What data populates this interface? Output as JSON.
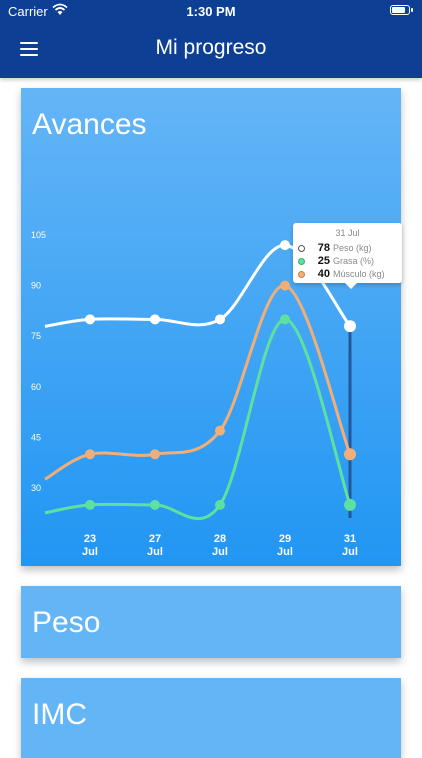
{
  "status_bar": {
    "carrier": "Carrier",
    "time": "1:30 PM"
  },
  "header": {
    "title": "Mi progreso",
    "menu_icon": "hamburger-menu-icon"
  },
  "cards": [
    {
      "title": "Avances"
    },
    {
      "title": "Peso"
    },
    {
      "title": "IMC"
    }
  ],
  "tooltip": {
    "date": "31 Jul",
    "rows": [
      {
        "value": "78",
        "label": "Peso (kg)"
      },
      {
        "value": "25",
        "label": "Grasa (%)"
      },
      {
        "value": "40",
        "label": "Músculo (kg)"
      }
    ]
  },
  "colors": {
    "header_bg": "#0d3f95",
    "card_gradient_top": "#64b5f6",
    "card_gradient_bottom": "#2196f3",
    "peso": "#ffffff",
    "grasa": "#5ee0a0",
    "musculo": "#f2ae76",
    "selection_line": "#24579a"
  },
  "chart_data": {
    "type": "line",
    "categories": [
      "23\nJul",
      "27\nJul",
      "28\nJul",
      "29\nJul",
      "31\nJul"
    ],
    "y_ticks": [
      30,
      45,
      60,
      75,
      90,
      105
    ],
    "ylim": [
      30,
      105
    ],
    "grid": false,
    "legend": "tooltip",
    "selected_index": 4,
    "series": [
      {
        "name": "Peso (kg)",
        "color": "#ffffff",
        "values": [
          80,
          80,
          80,
          102,
          78
        ]
      },
      {
        "name": "Grasa (%)",
        "color": "#5ee0a0",
        "values": [
          25,
          25,
          25,
          80,
          25
        ]
      },
      {
        "name": "Músculo (kg)",
        "color": "#f2ae76",
        "values": [
          40,
          40,
          47,
          90,
          40
        ]
      }
    ]
  }
}
